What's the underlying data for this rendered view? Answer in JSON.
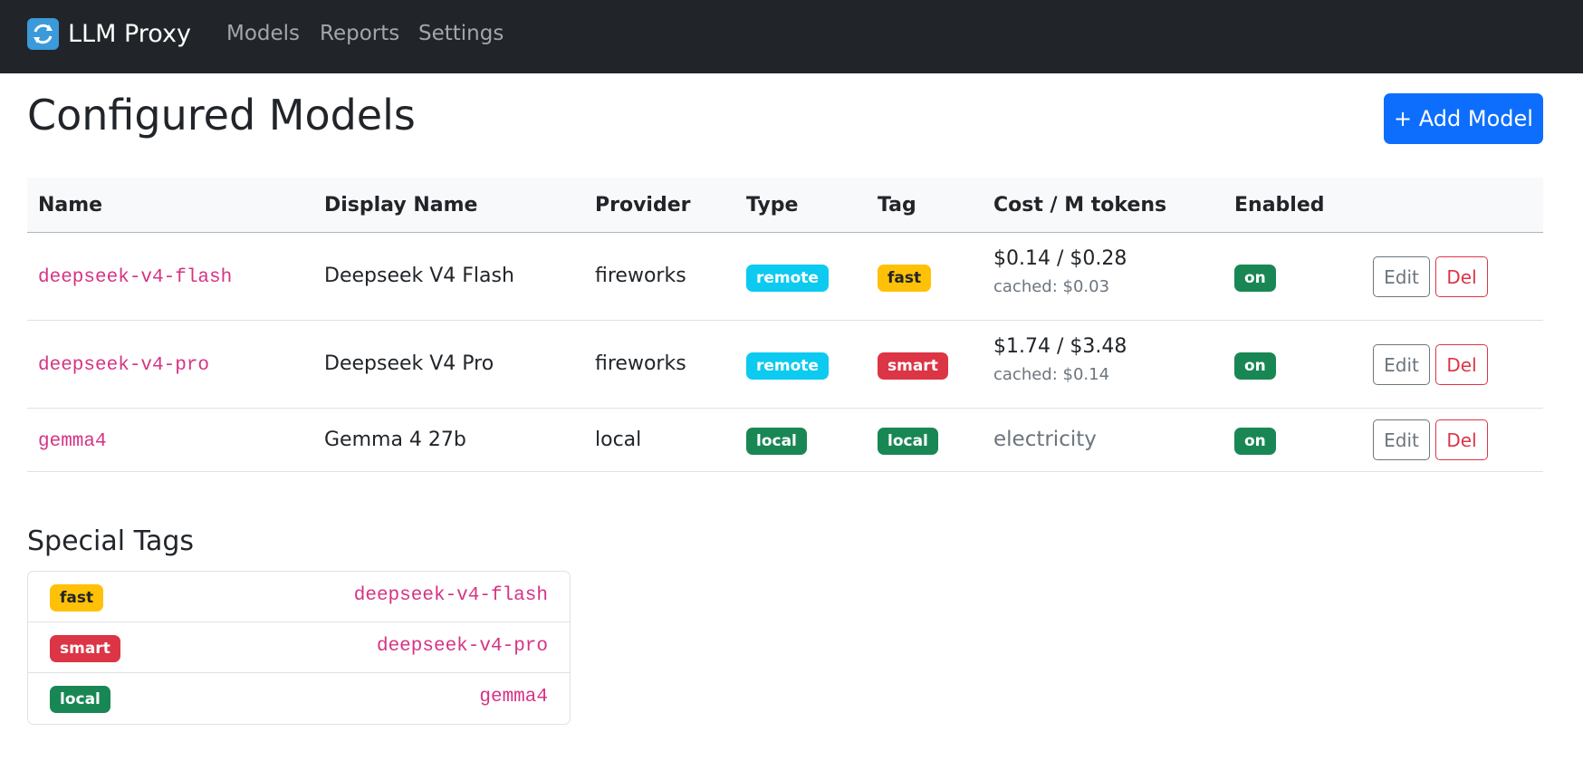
{
  "navbar": {
    "brand": "LLM Proxy",
    "brand_icon": "refresh-arrows-icon",
    "links": [
      "Models",
      "Reports",
      "Settings"
    ]
  },
  "page": {
    "title": "Configured Models",
    "add_button": "+ Add Model"
  },
  "table": {
    "headers": [
      "Name",
      "Display Name",
      "Provider",
      "Type",
      "Tag",
      "Cost / M tokens",
      "Enabled"
    ],
    "rows": [
      {
        "name": "deepseek-v4-flash",
        "display_name": "Deepseek V4 Flash",
        "provider": "fireworks",
        "type": "remote",
        "tag": "fast",
        "cost": "$0.14 / $0.28",
        "cached": "cached: $0.03",
        "enabled": "on",
        "edit": "Edit",
        "del": "Del"
      },
      {
        "name": "deepseek-v4-pro",
        "display_name": "Deepseek V4 Pro",
        "provider": "fireworks",
        "type": "remote",
        "tag": "smart",
        "cost": "$1.74 / $3.48",
        "cached": "cached: $0.14",
        "enabled": "on",
        "edit": "Edit",
        "del": "Del"
      },
      {
        "name": "gemma4",
        "display_name": "Gemma 4 27b",
        "provider": "local",
        "type": "local",
        "tag": "local",
        "cost": "electricity",
        "enabled": "on",
        "edit": "Edit",
        "del": "Del"
      }
    ]
  },
  "special_tags": {
    "title": "Special Tags",
    "items": [
      {
        "tag": "fast",
        "model": "deepseek-v4-flash"
      },
      {
        "tag": "smart",
        "model": "deepseek-v4-pro"
      },
      {
        "tag": "local",
        "model": "gemma4"
      }
    ]
  },
  "colors": {
    "navbar": "#212529",
    "primary": "#0d6efd",
    "info": "#0dcaf0",
    "warning": "#ffc107",
    "danger": "#dc3545",
    "success": "#198754",
    "code": "#d63384"
  }
}
